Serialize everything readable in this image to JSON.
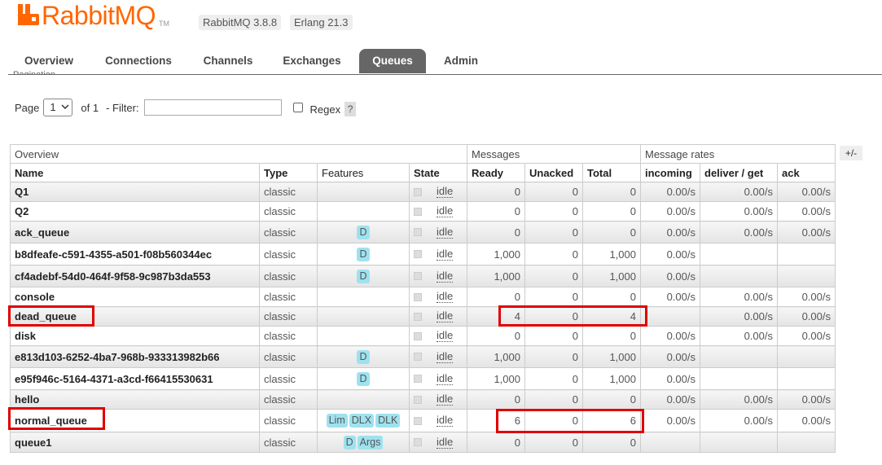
{
  "header": {
    "logo_text": "RabbitMQ",
    "logo_tm": "TM",
    "version_badge": "RabbitMQ 3.8.8",
    "erlang_badge": "Erlang 21.3",
    "brand_color": "#ff6600"
  },
  "tabs": [
    {
      "label": "Overview",
      "active": false
    },
    {
      "label": "Connections",
      "active": false
    },
    {
      "label": "Channels",
      "active": false
    },
    {
      "label": "Exchanges",
      "active": false
    },
    {
      "label": "Queues",
      "active": true
    },
    {
      "label": "Admin",
      "active": false
    }
  ],
  "pagination": {
    "section_label": "Pagination",
    "page_label": "Page",
    "page_value": "1",
    "of_label": "of 1",
    "filter_label": "- Filter:",
    "filter_value": "",
    "regex_label": "Regex",
    "help_label": "?"
  },
  "table": {
    "group_headers": {
      "overview": "Overview",
      "messages": "Messages",
      "rates": "Message rates"
    },
    "columns": {
      "name": "Name",
      "type": "Type",
      "features": "Features",
      "state": "State",
      "ready": "Ready",
      "unacked": "Unacked",
      "total": "Total",
      "incoming": "incoming",
      "deliver": "deliver / get",
      "ack": "ack"
    },
    "toggle_label": "+/-",
    "rows": [
      {
        "name": "Q1",
        "type": "classic",
        "features": [],
        "state": "idle",
        "ready": "0",
        "unacked": "0",
        "total": "0",
        "incoming": "0.00/s",
        "deliver": "0.00/s",
        "ack": "0.00/s"
      },
      {
        "name": "Q2",
        "type": "classic",
        "features": [],
        "state": "idle",
        "ready": "0",
        "unacked": "0",
        "total": "0",
        "incoming": "0.00/s",
        "deliver": "0.00/s",
        "ack": "0.00/s"
      },
      {
        "name": "ack_queue",
        "type": "classic",
        "features": [
          "D"
        ],
        "state": "idle",
        "ready": "0",
        "unacked": "0",
        "total": "0",
        "incoming": "0.00/s",
        "deliver": "0.00/s",
        "ack": "0.00/s"
      },
      {
        "name": "b8dfeafe-c591-4355-a501-f08b560344ec",
        "type": "classic",
        "features": [
          "D"
        ],
        "state": "idle",
        "ready": "1,000",
        "unacked": "0",
        "total": "1,000",
        "incoming": "0.00/s",
        "deliver": "",
        "ack": ""
      },
      {
        "name": "cf4adebf-54d0-464f-9f58-9c987b3da553",
        "type": "classic",
        "features": [
          "D"
        ],
        "state": "idle",
        "ready": "1,000",
        "unacked": "0",
        "total": "1,000",
        "incoming": "0.00/s",
        "deliver": "",
        "ack": ""
      },
      {
        "name": "console",
        "type": "classic",
        "features": [],
        "state": "idle",
        "ready": "0",
        "unacked": "0",
        "total": "0",
        "incoming": "0.00/s",
        "deliver": "0.00/s",
        "ack": "0.00/s"
      },
      {
        "name": "dead_queue",
        "type": "classic",
        "features": [],
        "state": "idle",
        "ready": "4",
        "unacked": "0",
        "total": "4",
        "incoming": "",
        "deliver": "0.00/s",
        "ack": "0.00/s"
      },
      {
        "name": "disk",
        "type": "classic",
        "features": [],
        "state": "idle",
        "ready": "0",
        "unacked": "0",
        "total": "0",
        "incoming": "0.00/s",
        "deliver": "0.00/s",
        "ack": "0.00/s"
      },
      {
        "name": "e813d103-6252-4ba7-968b-933313982b66",
        "type": "classic",
        "features": [
          "D"
        ],
        "state": "idle",
        "ready": "1,000",
        "unacked": "0",
        "total": "1,000",
        "incoming": "0.00/s",
        "deliver": "",
        "ack": ""
      },
      {
        "name": "e95f946c-5164-4371-a3cd-f66415530631",
        "type": "classic",
        "features": [
          "D"
        ],
        "state": "idle",
        "ready": "1,000",
        "unacked": "0",
        "total": "1,000",
        "incoming": "0.00/s",
        "deliver": "",
        "ack": ""
      },
      {
        "name": "hello",
        "type": "classic",
        "features": [],
        "state": "idle",
        "ready": "0",
        "unacked": "0",
        "total": "0",
        "incoming": "0.00/s",
        "deliver": "0.00/s",
        "ack": "0.00/s"
      },
      {
        "name": "normal_queue",
        "type": "classic",
        "features": [
          "Lim",
          "DLX",
          "DLK"
        ],
        "state": "idle",
        "ready": "6",
        "unacked": "0",
        "total": "6",
        "incoming": "0.00/s",
        "deliver": "0.00/s",
        "ack": "0.00/s"
      },
      {
        "name": "queue1",
        "type": "classic",
        "features": [
          "D",
          "Args"
        ],
        "state": "idle",
        "ready": "0",
        "unacked": "0",
        "total": "0",
        "incoming": "",
        "deliver": "",
        "ack": ""
      }
    ]
  },
  "annotations": {
    "highlight_color": "#e00000"
  }
}
